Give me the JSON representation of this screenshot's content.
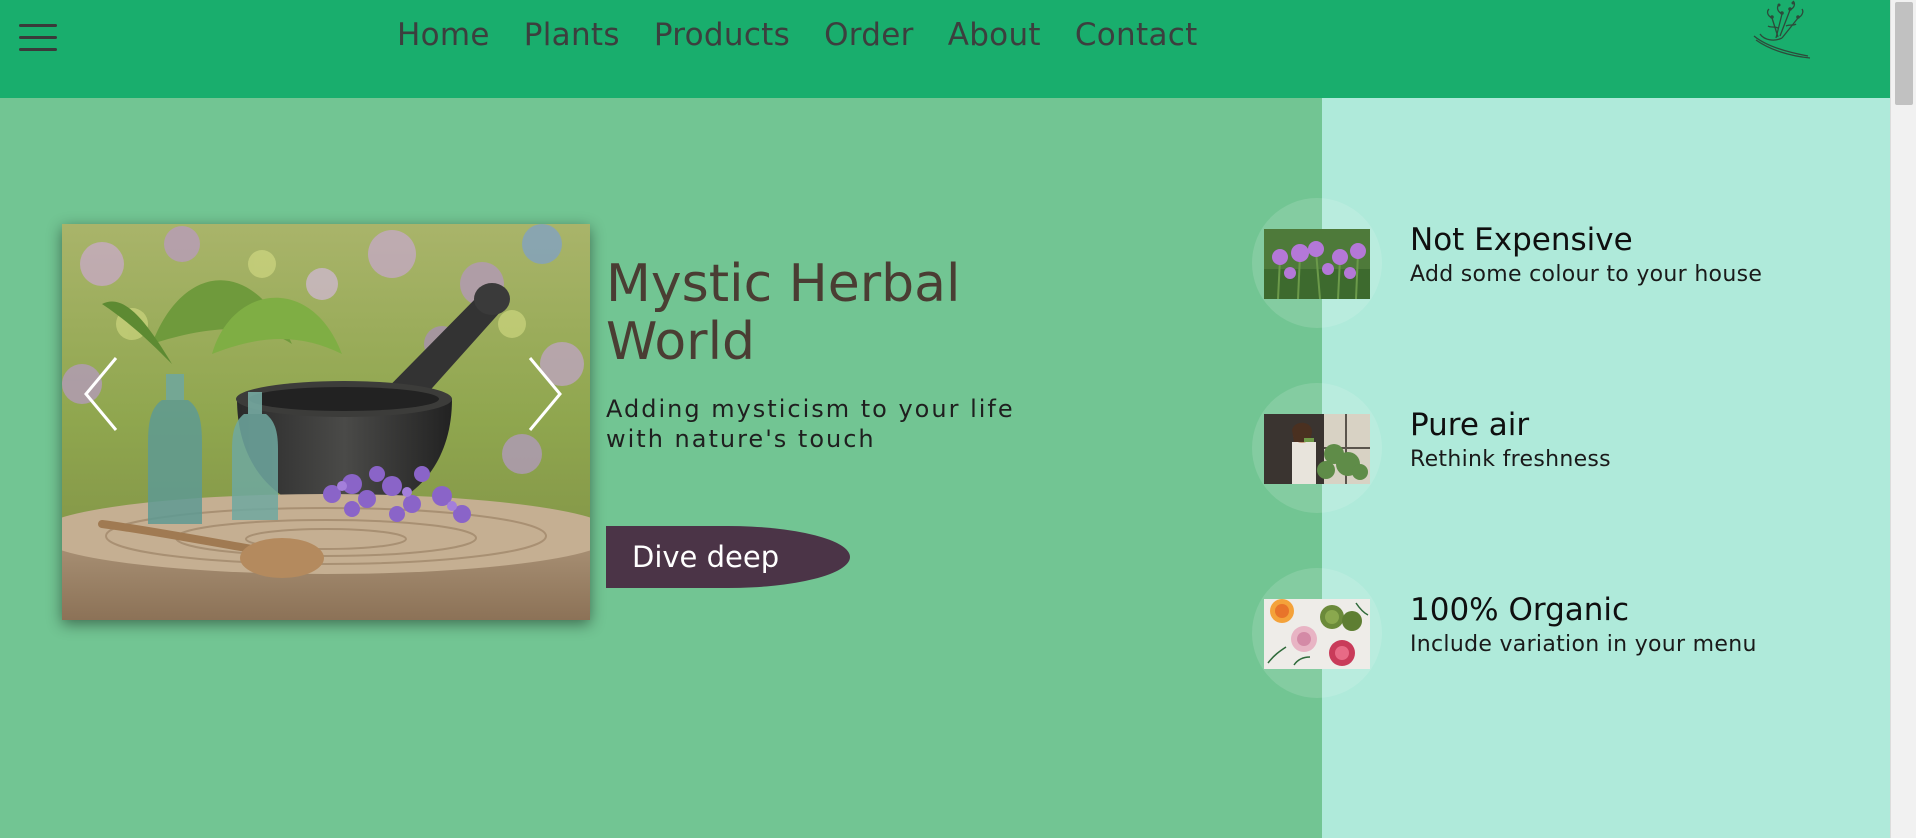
{
  "nav": {
    "menu_icon": "hamburger-menu-icon",
    "items": [
      {
        "label": "Home"
      },
      {
        "label": "Plants"
      },
      {
        "label": "Products"
      },
      {
        "label": "Order"
      },
      {
        "label": "About"
      },
      {
        "label": "Contact"
      }
    ],
    "logo_icon": "hand-holding-herbs-icon"
  },
  "hero": {
    "title": "Mystic Herbal World",
    "subtitle": "Adding mysticism to your life with nature's touch",
    "cta_label": "Dive deep",
    "carousel": {
      "prev_icon": "chevron-left-icon",
      "next_icon": "chevron-right-icon"
    }
  },
  "features": [
    {
      "title": "Not Expensive",
      "description": "Add some colour to your house"
    },
    {
      "title": "Pure air",
      "description": "Rethink freshness"
    },
    {
      "title": "100% Organic",
      "description": "Include variation in your menu"
    }
  ],
  "colors": {
    "header_bg": "#19ae6d",
    "hero_bg": "#72c593",
    "right_panel_bg": "#afeada",
    "cta_bg": "#4b3447",
    "title_color": "#4a3d33"
  }
}
